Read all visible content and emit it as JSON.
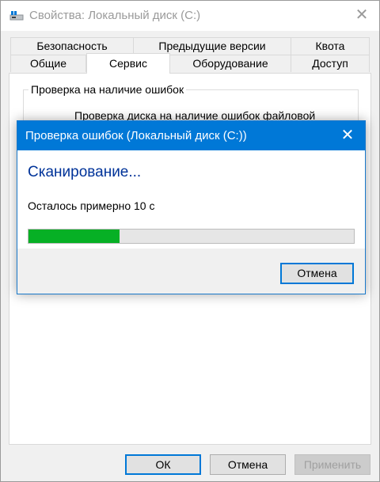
{
  "window": {
    "title": "Свойства: Локальный диск (C:)",
    "close_glyph": "✕"
  },
  "tabs": {
    "row1": [
      "Безопасность",
      "Предыдущие версии",
      "Квота"
    ],
    "row2": [
      "Общие",
      "Сервис",
      "Оборудование",
      "Доступ"
    ],
    "active": "Сервис"
  },
  "service": {
    "group_title": "Проверка на наличие ошибок",
    "group_text": "Проверка диска на наличие ошибок файловой"
  },
  "buttons": {
    "ok": "ОК",
    "cancel": "Отмена",
    "apply": "Применить"
  },
  "dialog": {
    "title": "Проверка ошибок (Локальный диск (C:))",
    "close_glyph": "✕",
    "heading": "Сканирование...",
    "remaining": "Осталось примерно 10 с",
    "progress_fraction": 0.28,
    "cancel_label": "Отмена"
  },
  "colors": {
    "accent": "#0078d7",
    "heading": "#003399",
    "progress": "#06b025"
  },
  "icons": {
    "app": "drive-icon",
    "close": "close-icon"
  }
}
